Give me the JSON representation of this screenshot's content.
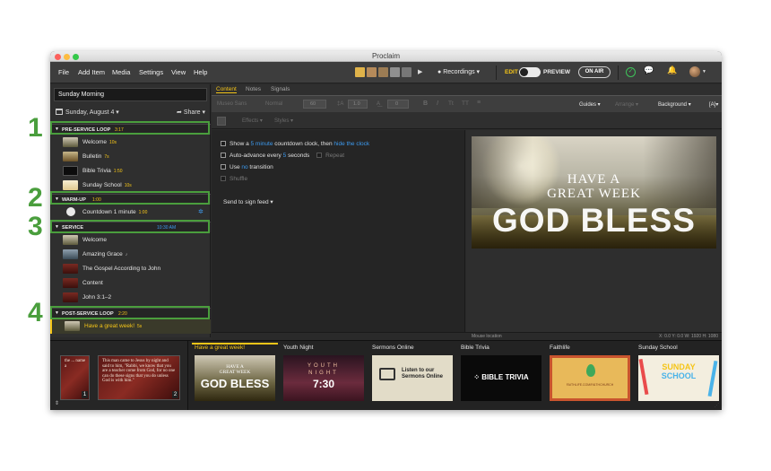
{
  "window": {
    "title": "Proclaim"
  },
  "menu": [
    "File",
    "Add Item",
    "Media",
    "Settings",
    "View",
    "Help"
  ],
  "toolbar": {
    "recordings": "Recordings ▾",
    "edit": "EDIT",
    "preview": "PREVIEW",
    "on_air": "ON AIR",
    "colors": {
      "accent": "#f5c518",
      "ok": "#3ec35a",
      "link": "#3d9bf0"
    }
  },
  "left": {
    "service_title": "Sunday Morning",
    "date": "Sunday, August 4 ▾",
    "share": "Share ▾",
    "sections": [
      {
        "name": "PRE-SERVICE LOOP",
        "duration": "3:17",
        "number": "1",
        "items": [
          {
            "label": "Welcome",
            "dur": "10s"
          },
          {
            "label": "Bulletin",
            "dur": "7s"
          },
          {
            "label": "Bible Trivia",
            "dur": "1:50"
          },
          {
            "label": "Sunday School",
            "dur": "10s"
          }
        ]
      },
      {
        "name": "WARM-UP",
        "duration": "1:00",
        "number": "2",
        "items": [
          {
            "label": "Countdown 1 minute",
            "dur": "1:00"
          }
        ]
      },
      {
        "name": "SERVICE",
        "duration": "10:30 AM",
        "number": "3",
        "items": [
          {
            "label": "Welcome",
            "dur": ""
          },
          {
            "label": "Amazing Grace",
            "dur": "♪"
          },
          {
            "label": "The Gospel According to John",
            "dur": ""
          },
          {
            "label": "Content",
            "dur": ""
          },
          {
            "label": "John 3:1–2",
            "dur": ""
          }
        ]
      },
      {
        "name": "POST-SERVICE LOOP",
        "duration": "2:20",
        "number": "4",
        "items": [
          {
            "label": "Have a great week!",
            "dur": "5s"
          }
        ]
      }
    ]
  },
  "editor": {
    "tabs": [
      "Content",
      "Notes",
      "Signals"
    ],
    "fmt": {
      "font": "Museo Sans",
      "weight": "Normal",
      "size": "60",
      "leading": "1.0",
      "spacing": "0",
      "guides": "Guides ▾",
      "arrange": "Arrange ▾",
      "background": "Background ▾",
      "effects": "Effects ▾",
      "styles": "Styles ▾"
    },
    "options": {
      "show_pre": "Show a",
      "minute_link": "5 minute",
      "show_mid": "countdown clock, then",
      "hide_link": "hide the clock",
      "auto_pre": "Auto-advance every",
      "auto_secs": "5",
      "auto_post": "seconds",
      "repeat": "Repeat",
      "use_pre": "Use",
      "use_link": "no",
      "use_post": "transition",
      "shuffle": "Shuffle",
      "sign_feed": "Send to sign feed ▾"
    }
  },
  "slide": {
    "line1": "HAVE A",
    "line2": "GREAT WEEK",
    "line3": "GOD BLESS"
  },
  "status": {
    "mouse": "Mouse location",
    "coords": "X: 0.0  Y: 0.0   W: 1920  H: 1080"
  },
  "minis": [
    {
      "text": "the ... name a",
      "badge": "1"
    },
    {
      "text": "This man came to Jesus by night and said to him, \"Rabbi, we know that you are a teacher come from God, for no one can do these signs that you do unless God is with him.\"",
      "badge": "2"
    }
  ],
  "library": [
    {
      "title": "Have a great week!",
      "caption": "HAVE A GREAT WEEK GOD BLESS"
    },
    {
      "title": "Youth Night",
      "caption": "YOUTH NIGHT 7:30"
    },
    {
      "title": "Sermons Online",
      "caption": "Listen to our Sermons Online"
    },
    {
      "title": "Bible Trivia",
      "caption": "BIBLE TRIVIA"
    },
    {
      "title": "Faithlife",
      "caption": "FAITHLIFE.COM/FAITHCHURCH"
    },
    {
      "title": "Sunday School",
      "caption": "SUNDAY SCHOOL"
    }
  ]
}
